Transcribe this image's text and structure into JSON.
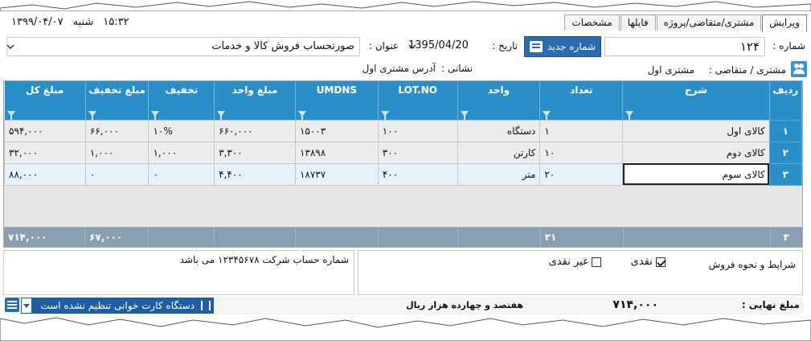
{
  "app": {
    "time": "۱۵:۳۲",
    "day": "شنبه",
    "date": "۱۳۹۹/۰۴/۰۷"
  },
  "tabs": [
    {
      "label": "ویرایش",
      "active": true
    },
    {
      "label": "مشتری/متقاضی/پروژه",
      "active": false
    },
    {
      "label": "فایلها",
      "active": false
    },
    {
      "label": "مشخصات",
      "active": false
    }
  ],
  "header": {
    "number_label": "شماره :",
    "number_value": "۱۲۴",
    "new_number_button": "شماره جدید",
    "date_label": "تاریخ :",
    "date_value": "1395/04/20",
    "title_label": "عنوان :",
    "title_value": "صورتحساب فروش کالا و خدمات",
    "customer_label": "مشتری / متقاضی :",
    "customer_value": "مشتری اول",
    "address_label": "نشانی :",
    "address_value": "آدرس مشتری اول"
  },
  "grid": {
    "columns": [
      "ردیف",
      "شرح",
      "تعداد",
      "واحد",
      "LOT.NO",
      "UMDNS",
      "مبلغ واحد",
      "تخفیف",
      "مبلغ تخفیف",
      "مبلغ کل"
    ],
    "rows": [
      {
        "no": "۱",
        "desc": "کالای اول",
        "qty": "۱",
        "unit": "دستگاه",
        "lot": "۱۰۰",
        "umdns": "۱۵۰۰۳",
        "unit_price": "۶۶۰,۰۰۰",
        "discount": "۱۰%",
        "discount_amount": "۶۶,۰۰۰",
        "total": "۵۹۴,۰۰۰"
      },
      {
        "no": "۲",
        "desc": "کالای دوم",
        "qty": "۱۰",
        "unit": "کارتن",
        "lot": "۳۰۰",
        "umdns": "۱۳۸۹۸",
        "unit_price": "۳,۳۰۰",
        "discount": "۱,۰۰۰",
        "discount_amount": "۱,۰۰۰",
        "total": "۳۲,۰۰۰"
      },
      {
        "no": "۳",
        "desc": "کالای سوم",
        "qty": "۲۰",
        "unit": "متر",
        "lot": "۴۰۰",
        "umdns": "۱۸۷۳۷",
        "unit_price": "۴,۴۰۰",
        "discount": "۰",
        "discount_amount": "۰",
        "total": "۸۸,۰۰۰"
      }
    ],
    "footer": {
      "row_count": "۳",
      "qty_total": "۳۱",
      "discount_total": "۶۷,۰۰۰",
      "grand_total": "۷۱۴,۰۰۰"
    }
  },
  "notes": {
    "text": "شماره حساب شرکت ۱۲۳۴۵۶۷۸ می باشد"
  },
  "sales_terms": {
    "label": "شرایط و نحوه فروش",
    "cash_label": "نقدی",
    "cash_checked": true,
    "noncash_label": "غیر نقدی",
    "noncash_checked": false
  },
  "status": {
    "final_amount_label": "مبلغ نهایی :",
    "final_amount_value": "۷۱۴,۰۰۰",
    "amount_words": "هفتصد و چهارده هزار  ریال",
    "card_reader": "دستگاه کارت خوانی تنظیم نشده است"
  },
  "colors": {
    "header_blue": "#2a8fc9",
    "button_blue": "#2b6cb0",
    "footer_gray": "#8aa0b0"
  }
}
